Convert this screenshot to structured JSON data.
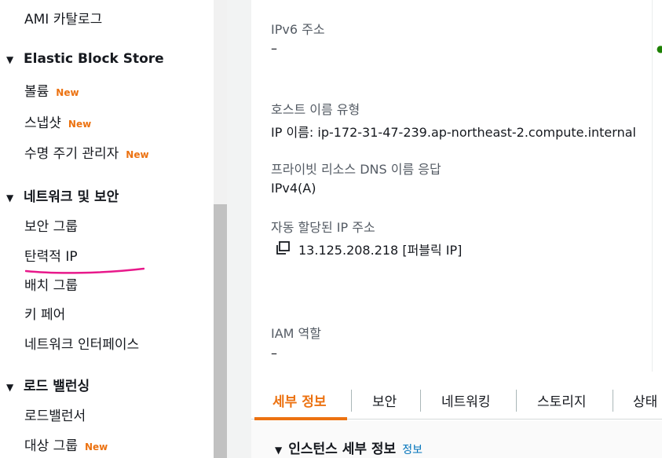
{
  "sidebar": {
    "items": [
      {
        "label": "AMI 카탈로그"
      },
      {
        "label": "볼륨",
        "badge": "New"
      },
      {
        "label": "스냅샷",
        "badge": "New"
      },
      {
        "label": "수명 주기 관리자",
        "badge": "New"
      },
      {
        "label": "보안 그룹"
      },
      {
        "label": "탄력적 IP"
      },
      {
        "label": "배치 그룹"
      },
      {
        "label": "키 페어"
      },
      {
        "label": "네트워크 인터페이스"
      },
      {
        "label": "로드밸런서"
      },
      {
        "label": "대상 그룹",
        "badge": "New"
      }
    ],
    "sections": [
      {
        "title": "Elastic Block Store"
      },
      {
        "title": "네트워크 및 보안"
      },
      {
        "title": "로드 밸런싱"
      }
    ]
  },
  "details": {
    "ipv6_label": "IPv6 주소",
    "ipv6_value": "–",
    "hostname_type_label": "호스트 이름 유형",
    "hostname_type_value": "IP 이름: ip-172-31-47-239.ap-northeast-2.compute.internal",
    "private_dns_label": "프라이빗 리소스 DNS 이름 응답",
    "private_dns_value": "IPv4(A)",
    "auto_ip_label": "자동 할당된 IP 주소",
    "auto_ip_value": "13.125.208.218 [퍼블릭 IP]",
    "iam_label": "IAM 역할",
    "iam_value": "–"
  },
  "tabs": [
    {
      "label": "세부 정보",
      "active": true
    },
    {
      "label": "보안"
    },
    {
      "label": "네트워킹"
    },
    {
      "label": "스토리지"
    },
    {
      "label": "상태"
    }
  ],
  "section": {
    "title": "인스턴스 세부 정보",
    "info_link": "정보"
  },
  "colors": {
    "accent": "#ec7211",
    "link": "#0073bb",
    "annotation": "#e8198b"
  }
}
